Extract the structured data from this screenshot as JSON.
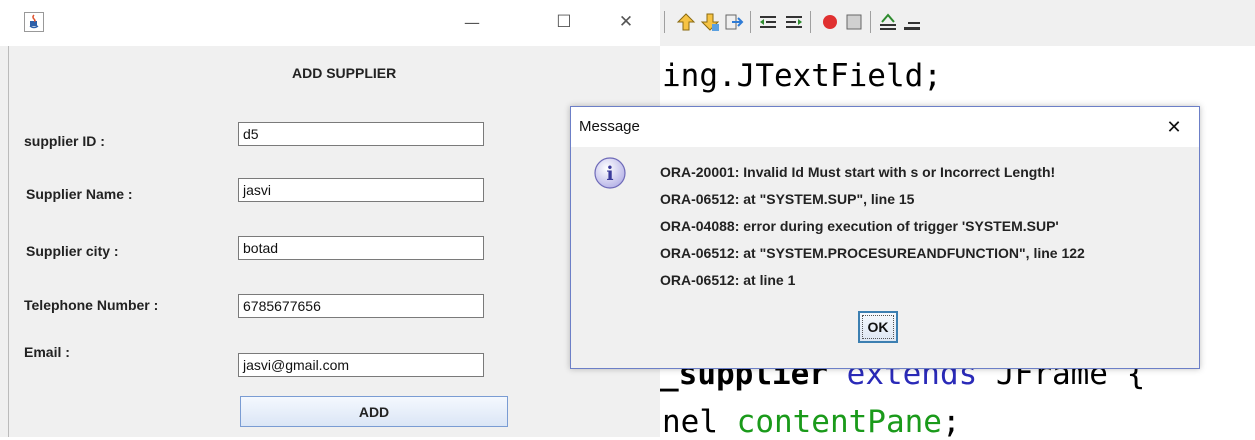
{
  "editor": {
    "code_lines": [
      "ing.JTextField;",
      "_supplier extends JFrame {",
      "nel contentPane;"
    ]
  },
  "frame": {
    "heading": "ADD SUPPLIER",
    "window_controls": {
      "minimize": "—",
      "maximize": "☐",
      "close": "✕"
    },
    "fields": [
      {
        "label": "supplier ID :",
        "value": "d5"
      },
      {
        "label": "Supplier Name :",
        "value": "jasvi"
      },
      {
        "label": "Supplier city :",
        "value": "botad"
      },
      {
        "label": "Telephone Number :",
        "value": "6785677656"
      },
      {
        "label": "Email :",
        "value": "jasvi@gmail.com"
      }
    ],
    "add_button": "ADD"
  },
  "dialog": {
    "title": "Message",
    "close": "✕",
    "messages": [
      "ORA-20001: Invalid Id Must start with s or Incorrect Length!",
      "ORA-06512: at \"SYSTEM.SUP\", line 15",
      "ORA-04088: error during execution of trigger 'SYSTEM.SUP'",
      "ORA-06512: at \"SYSTEM.PROCESUREANDFUNCTION\", line 122",
      "ORA-06512: at line 1"
    ],
    "ok_button": "OK",
    "info_icon_glyph": "i"
  },
  "colors": {
    "dialog_border": "#6c7fc7",
    "info_icon_fill": "#b9b6e8",
    "code_keyword_blue": "#2a2ab8",
    "code_type_green": "#1a9a1a"
  }
}
